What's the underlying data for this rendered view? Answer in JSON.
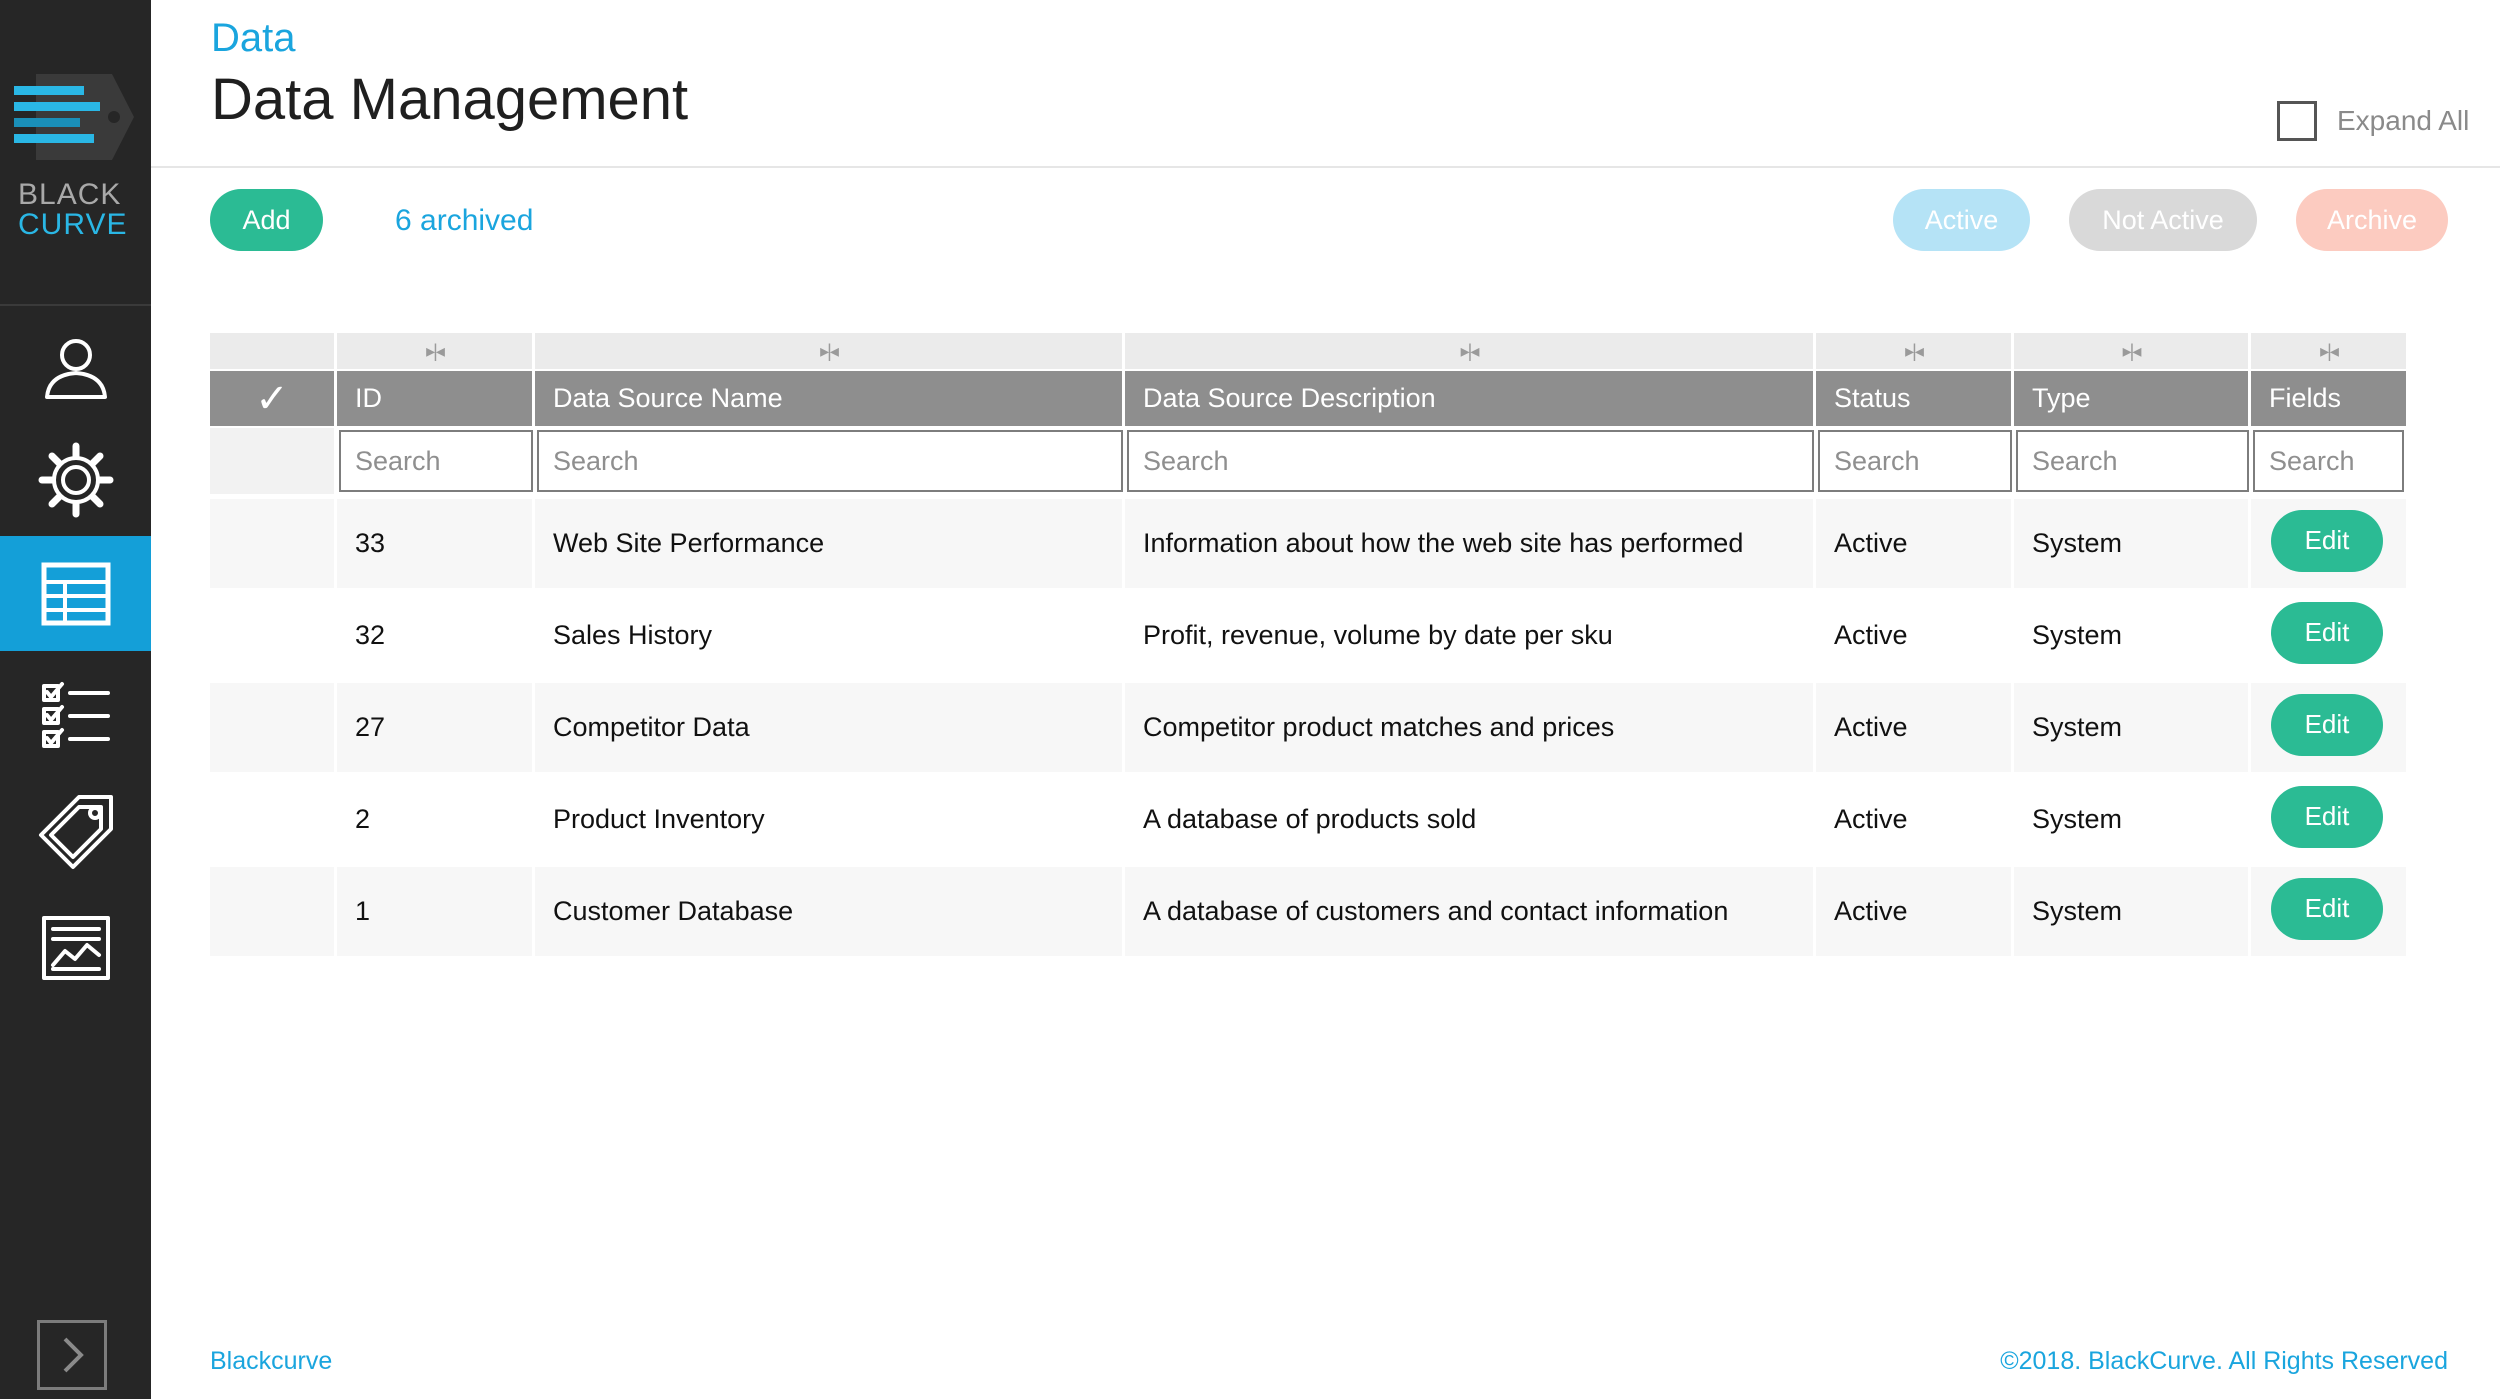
{
  "brand": {
    "line1": "BLACK",
    "line2": "CURVE"
  },
  "nav": [
    {
      "name": "user-icon"
    },
    {
      "name": "gear-icon"
    },
    {
      "name": "table-icon",
      "active": true
    },
    {
      "name": "checklist-icon"
    },
    {
      "name": "tag-icon"
    },
    {
      "name": "report-icon"
    }
  ],
  "header": {
    "breadcrumb": "Data",
    "title": "Data Management",
    "expand_all_label": "Expand All"
  },
  "toolbar": {
    "add_label": "Add",
    "archived_link": "6 archived",
    "active_label": "Active",
    "not_active_label": "Not Active",
    "archive_label": "Archive"
  },
  "table": {
    "check_glyph": "✓",
    "resize_glyph": "▸|◂",
    "columns": [
      "ID",
      "Data Source Name",
      "Data Source Description",
      "Status",
      "Type",
      "Fields"
    ],
    "search_placeholder": "Search",
    "edit_label": "Edit",
    "rows": [
      {
        "id": "33",
        "name": "Web Site Performance",
        "description": "Information about how the web site has performed",
        "status": "Active",
        "type": "System"
      },
      {
        "id": "32",
        "name": "Sales History",
        "description": "Profit, revenue, volume by date per sku",
        "status": "Active",
        "type": "System"
      },
      {
        "id": "27",
        "name": "Competitor Data",
        "description": "Competitor product matches and prices",
        "status": "Active",
        "type": "System"
      },
      {
        "id": "2",
        "name": "Product Inventory",
        "description": "A database of products sold",
        "status": "Active",
        "type": "System"
      },
      {
        "id": "1",
        "name": "Customer Database",
        "description": "A database of customers and contact information",
        "status": "Active",
        "type": "System"
      }
    ]
  },
  "footer": {
    "left": "Blackcurve",
    "right": "©2018. BlackCurve. All Rights Reserved"
  },
  "colors": {
    "sidebar": "#262626",
    "accent_blue": "#1aa5de",
    "nav_active": "#149fd8",
    "green": "#2bbb94",
    "header_gray": "#8e8e8e"
  }
}
